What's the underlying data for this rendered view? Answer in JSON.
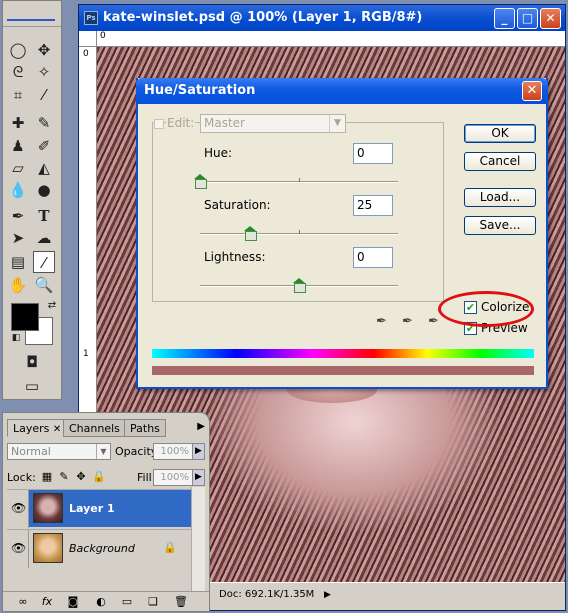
{
  "document": {
    "title": "kate-winslet.psd @ 100% (Layer 1, RGB/8#)",
    "ruler_top_labels": [
      "0"
    ],
    "ruler_side_labels": [
      "0",
      "1"
    ],
    "status_info": "Doc: 692.1K/1.35M"
  },
  "dialog": {
    "title": "Hue/Saturation",
    "edit_label": "Edit:",
    "edit_value": "Master",
    "hue_label": "Hue:",
    "hue_value": "0",
    "saturation_label": "Saturation:",
    "saturation_value": "25",
    "lightness_label": "Lightness:",
    "lightness_value": "0",
    "hue_level": 0.0,
    "saturation_level": 0.25,
    "lightness_level": 0.5,
    "ok_label": "OK",
    "cancel_label": "Cancel",
    "load_label": "Load...",
    "save_label": "Save...",
    "colorize_label": "Colorize",
    "colorize_checked": true,
    "preview_label": "Preview",
    "preview_checked": true,
    "highlight_color": "#e01010"
  },
  "layers_panel": {
    "tabs": [
      {
        "label": "Layers",
        "active": true
      },
      {
        "label": "Channels",
        "active": false
      },
      {
        "label": "Paths",
        "active": false
      }
    ],
    "blend_mode": "Normal",
    "opacity_label": "Opacity:",
    "opacity_value": "100%",
    "lock_label": "Lock:",
    "fill_label": "Fill:",
    "fill_value": "100%",
    "layers": [
      {
        "name": "Layer 1",
        "selected": true
      },
      {
        "name": "Background",
        "selected": false,
        "locked": true
      }
    ]
  },
  "icons": {
    "tools": [
      "marquee-icon",
      "move-icon",
      "lasso-icon",
      "magic-wand-icon",
      "crop-icon",
      "slice-icon",
      "healing-icon",
      "brush-icon",
      "stamp-icon",
      "history-brush-icon",
      "eraser-icon",
      "bucket-icon",
      "blur-icon",
      "dodge-icon",
      "pen-icon",
      "type-icon",
      "path-select-icon",
      "shape-icon",
      "notes-icon",
      "eyedropper-icon",
      "hand-icon",
      "zoom-icon"
    ],
    "footer": [
      "link-icon",
      "fx-icon",
      "mask-icon",
      "adjustment-icon",
      "group-icon",
      "new-layer-icon",
      "trash-icon"
    ]
  }
}
